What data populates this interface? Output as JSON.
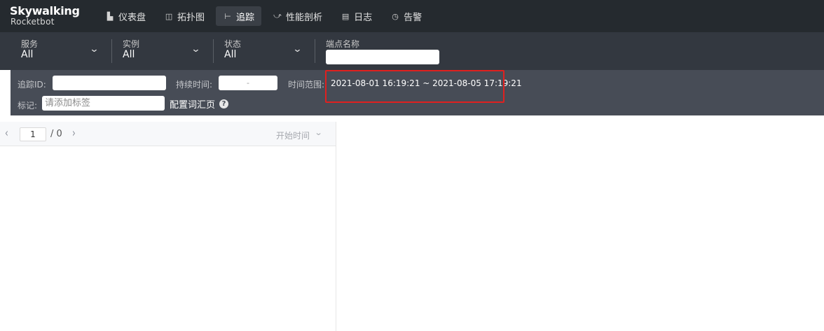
{
  "brand": {
    "name": "Skywalking",
    "sub": "Rocketbot"
  },
  "nav": [
    {
      "label": "仪表盘",
      "icon": "dashboard-icon",
      "glyph": "▙"
    },
    {
      "label": "拓扑图",
      "icon": "topology-icon",
      "glyph": "◫"
    },
    {
      "label": "追踪",
      "icon": "trace-icon",
      "glyph": "⊢",
      "active": true
    },
    {
      "label": "性能剖析",
      "icon": "profile-icon",
      "glyph": "⤻"
    },
    {
      "label": "日志",
      "icon": "log-icon",
      "glyph": "▤"
    },
    {
      "label": "告警",
      "icon": "alarm-icon",
      "glyph": "◷"
    }
  ],
  "filters": {
    "service": {
      "label": "服务",
      "value": "All"
    },
    "instance": {
      "label": "实例",
      "value": "All"
    },
    "status": {
      "label": "状态",
      "value": "All"
    },
    "endpoint": {
      "label": "端点名称",
      "value": ""
    }
  },
  "query": {
    "trace_id_label": "追踪ID:",
    "trace_id_value": "",
    "duration_label": "持续时间:",
    "duration_sep": "-",
    "time_range_label": "时间范围:",
    "time_range_value": "2021-08-01 16:19:21 ~ 2021-08-05 17:19:21",
    "tags_label": "标记:",
    "tags_placeholder": "请添加标签",
    "vocab_link": "配置词汇页",
    "help_glyph": "?"
  },
  "pager": {
    "current_page": "1",
    "total": "/ 0",
    "sort_label": "开始时间"
  },
  "colors": {
    "topbar": "#252a2f",
    "filterbar": "#333840",
    "querybar": "#474c56",
    "highlight": "#e0201f"
  }
}
